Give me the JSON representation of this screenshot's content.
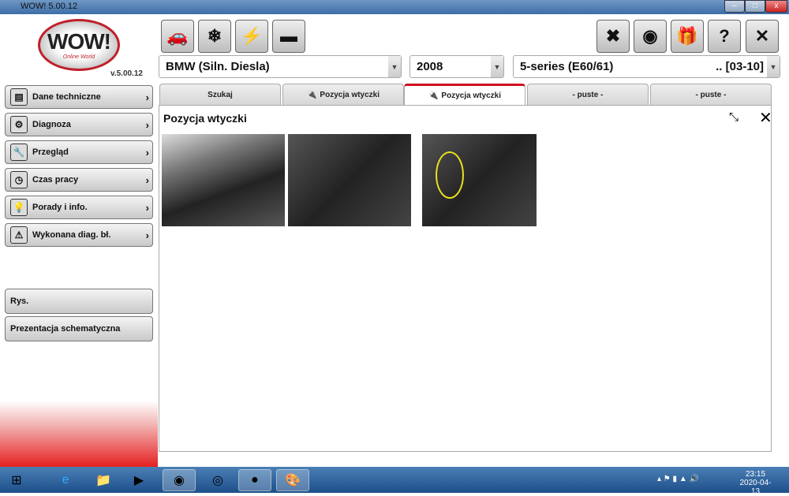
{
  "window": {
    "title": "WOW! 5.00.12",
    "minimize": "–",
    "maximize": "□",
    "close": "x"
  },
  "logo": {
    "text": "WOW!",
    "sub": "Online World"
  },
  "version": "v.5.00.12",
  "sidebar": {
    "items": [
      {
        "label": "Dane techniczne",
        "icon": "book-icon",
        "glyph": "▤"
      },
      {
        "label": "Diagnoza",
        "icon": "diagnosis-icon",
        "glyph": "⚙"
      },
      {
        "label": "Przegląd",
        "icon": "wrench-icon",
        "glyph": "🔧"
      },
      {
        "label": "Czas pracy",
        "icon": "clock-icon",
        "glyph": "◷"
      },
      {
        "label": "Porady i info.",
        "icon": "lightbulb-icon",
        "glyph": "💡"
      },
      {
        "label": "Wykonana diag. bł.",
        "icon": "diag-error-icon",
        "glyph": "⚠"
      }
    ],
    "extra": [
      "Rys.",
      "Prezentacja schematyczna"
    ]
  },
  "toolbar_left": [
    {
      "icon": "cars-icon",
      "glyph": "🚗"
    },
    {
      "icon": "snowflake-icon",
      "glyph": "❄"
    },
    {
      "icon": "engine-icon",
      "glyph": "⚡"
    },
    {
      "icon": "battery-tools-icon",
      "glyph": "▬"
    }
  ],
  "toolbar_right": [
    {
      "icon": "tools-icon",
      "glyph": "✖"
    },
    {
      "icon": "sync-icon",
      "glyph": "◉"
    },
    {
      "icon": "gift-icon",
      "glyph": "🎁"
    },
    {
      "icon": "help-icon",
      "glyph": "?"
    },
    {
      "icon": "close-icon",
      "glyph": "✕"
    }
  ],
  "selectors": {
    "make": "BMW (Siln. Diesla)",
    "year": "2008",
    "model": "5-series (E60/61)",
    "model_years": ".. [03-10]"
  },
  "tabs": [
    {
      "label": "Szukaj",
      "plug": false
    },
    {
      "label": "Pozycja wtyczki",
      "plug": true
    },
    {
      "label": "Pozycja wtyczki",
      "plug": true,
      "active": true
    },
    {
      "label": "-  puste  -",
      "plug": false
    },
    {
      "label": "-  puste  -",
      "plug": false
    }
  ],
  "panel": {
    "title": "Pozycja wtyczki"
  },
  "taskbar": {
    "time": "23:15",
    "date": "2020-04-13"
  }
}
